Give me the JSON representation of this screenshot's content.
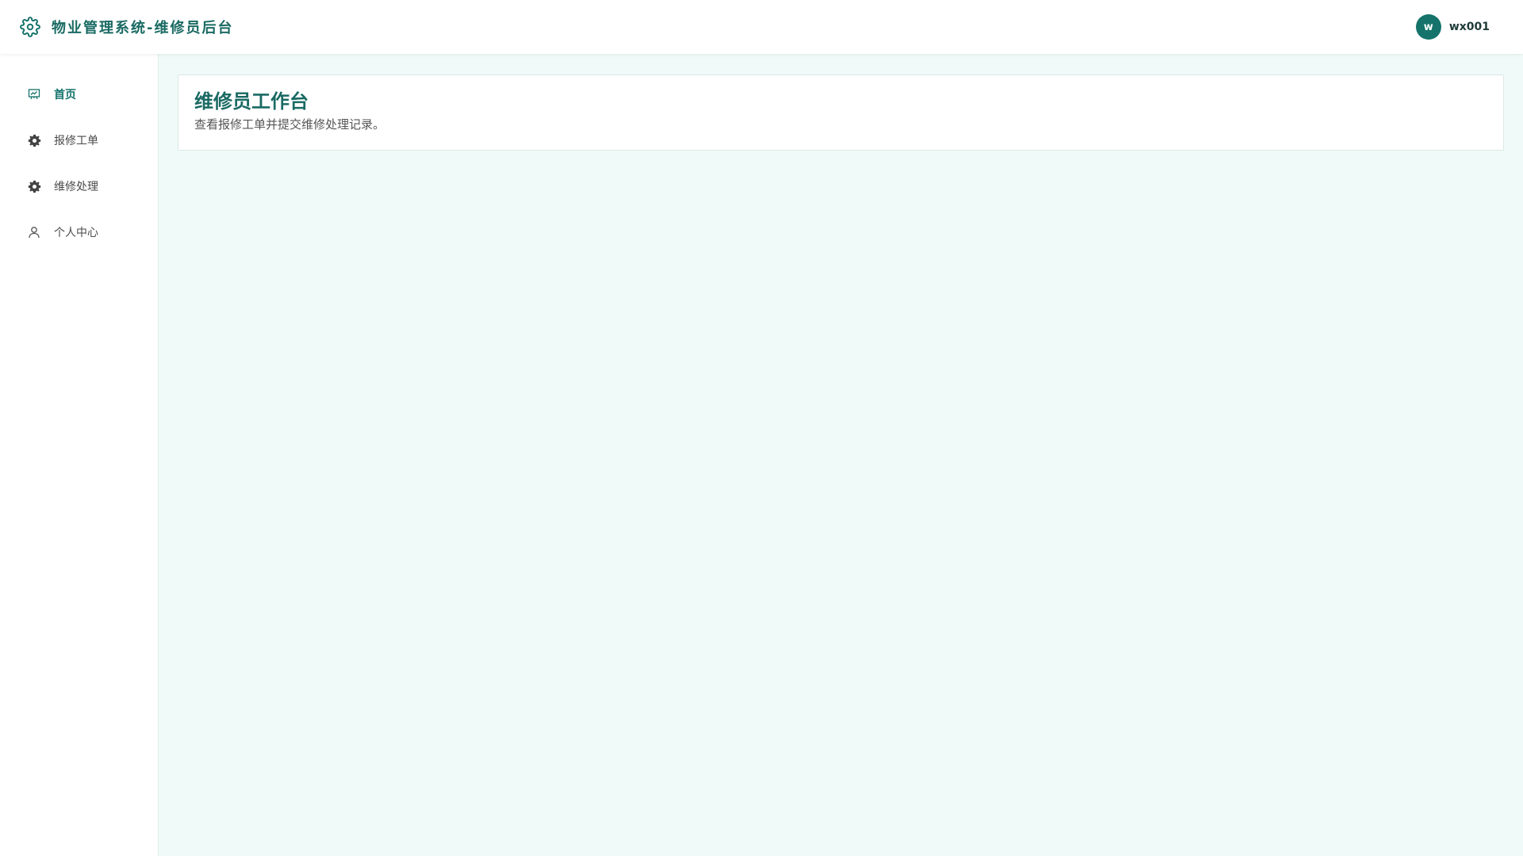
{
  "header": {
    "title": "物业管理系统-维修员后台",
    "logo_icon": "gear-icon",
    "user": {
      "avatar_letter": "w",
      "name": "wx001"
    }
  },
  "sidebar": {
    "items": [
      {
        "label": "首页",
        "icon": "presentation-icon",
        "active": true
      },
      {
        "label": "报修工单",
        "icon": "gear-icon",
        "active": false
      },
      {
        "label": "维修处理",
        "icon": "gear-icon",
        "active": false
      },
      {
        "label": "个人中心",
        "icon": "user-icon",
        "active": false
      }
    ]
  },
  "main": {
    "card": {
      "title": "维修员工作台",
      "subtitle": "查看报修工单并提交维修处理记录。"
    }
  },
  "colors": {
    "accent": "#15736b",
    "title": "#1a6a63",
    "background": "#f0fbf9"
  }
}
